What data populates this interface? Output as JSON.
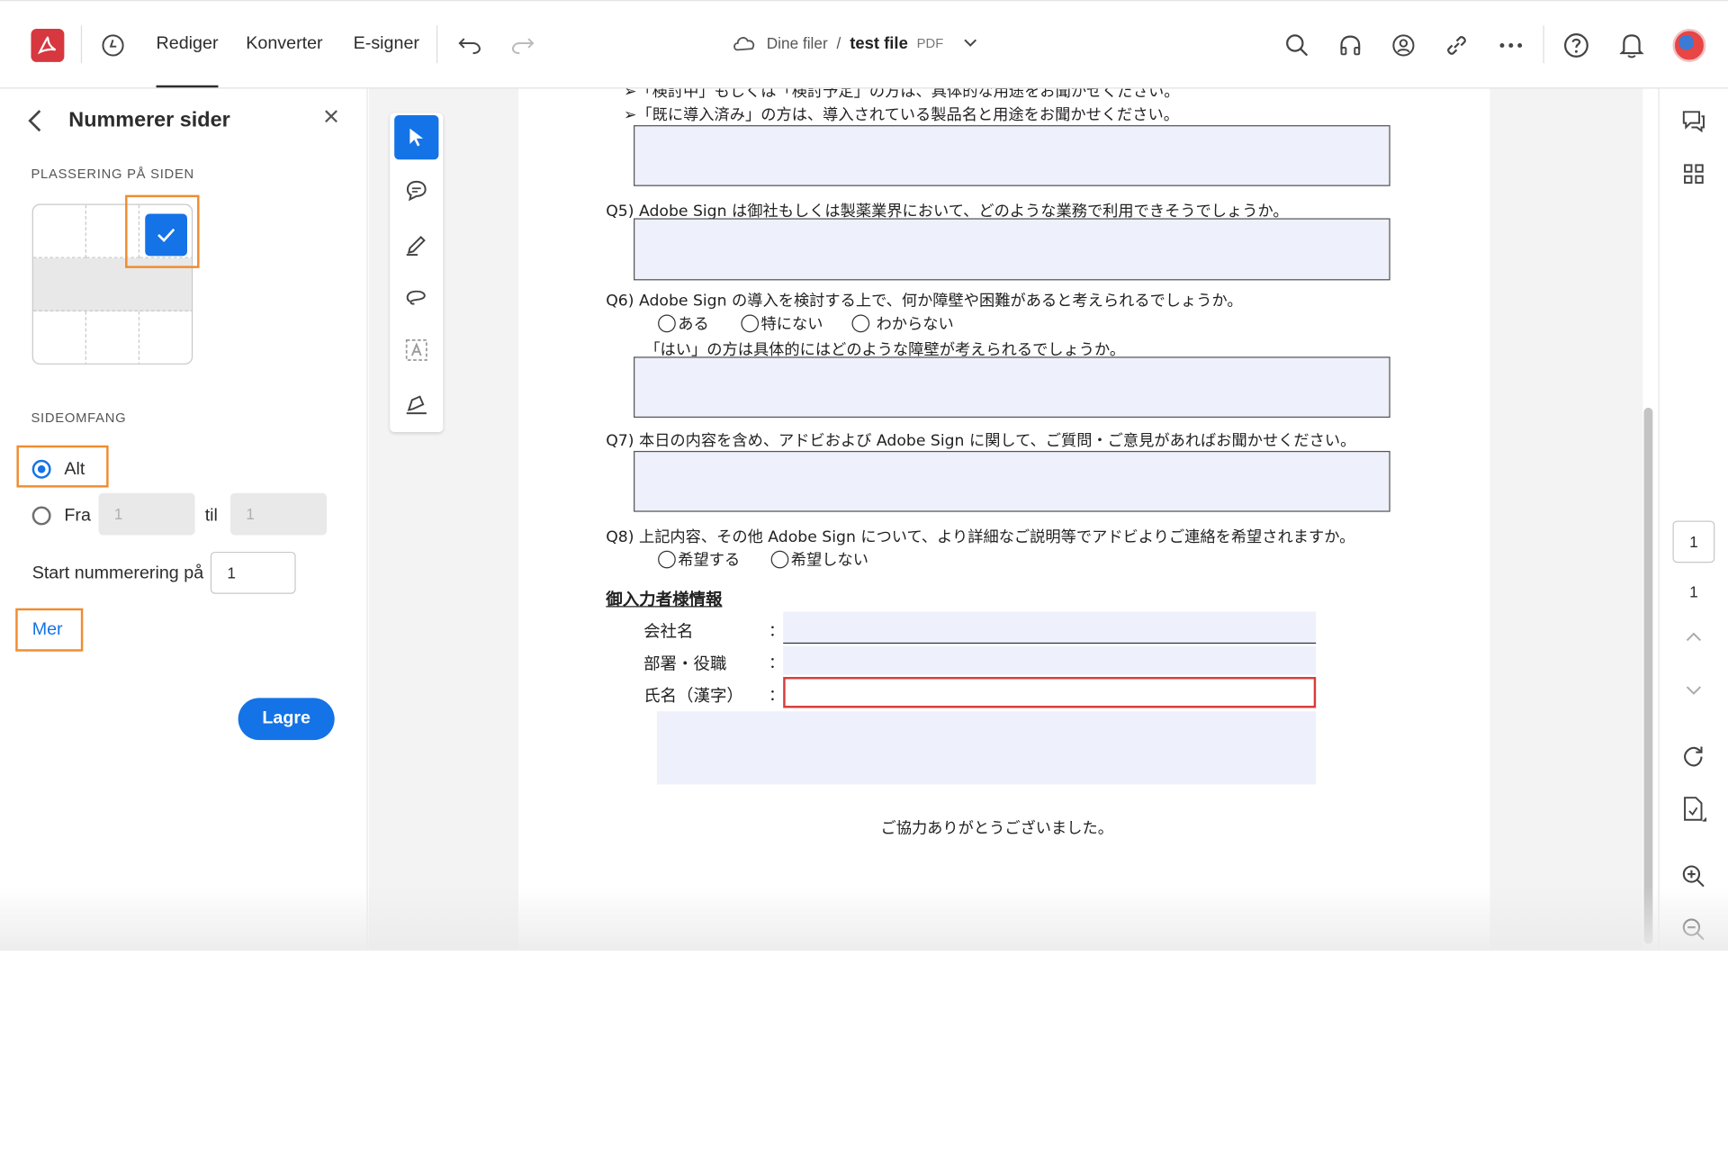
{
  "app": {
    "logo_glyph": "A",
    "brand_color": "#d7373f",
    "accent_color": "#1473e6",
    "highlight_color": "#f08c30"
  },
  "nav": {
    "tabs": [
      "Rediger",
      "Konverter",
      "E-signer"
    ],
    "active_tab": "Rediger"
  },
  "breadcrumb": {
    "location": "Dine filer",
    "separator": "/",
    "file_name": "test file",
    "file_type": "PDF"
  },
  "panel": {
    "title": "Nummerer sider",
    "placement_label": "PLASSERING PÅ SIDEN",
    "selected_position": "top-right",
    "range_label": "SIDEOMFANG",
    "option_all": "Alt",
    "option_from": "Fra",
    "from_value": "1",
    "to_label": "til",
    "to_value": "1",
    "start_label": "Start nummerering på",
    "start_value": "1",
    "more_link": "Mer",
    "save_button": "Lagre"
  },
  "document": {
    "line_a": "➢「検討中」もしくは「検討予定」の方は、具体的な用途をお聞かせください。",
    "line_b": "➢「既に導入済み」の方は、導入されている製品名と用途をお聞かせください。",
    "q5": "Q5) Adobe Sign は御社もしくは製薬業界において、どのような業務で利用できそうでしょうか。",
    "q6": "Q6) Adobe Sign の導入を検討する上で、何か障壁や困難があると考えられるでしょうか。",
    "q6_options": [
      "ある",
      "特にない",
      "わからない"
    ],
    "q6_follow": "「はい」の方は具体的にはどのような障壁が考えられるでしょうか。",
    "q7": "Q7) 本日の内容を含め、アドビおよび Adobe Sign に関して、ご質問・ご意見があればお聞かせください。",
    "q8": "Q8) 上記内容、その他 Adobe Sign について、より詳細なご説明等でアドビよりご連絡を希望されますか。",
    "q8_options": [
      "希望する",
      "希望しない"
    ],
    "info_heading": "御入力者様情報",
    "fields": [
      "会社名",
      "部署・役職",
      "氏名（漢字）"
    ],
    "colon": "：",
    "thanks": "ご協力ありがとうございました。"
  },
  "pagination": {
    "current_page": "1",
    "total_pages": "1"
  },
  "icons": [
    "history-icon",
    "undo-icon",
    "redo-icon",
    "cloud-icon",
    "chevron-down-icon",
    "search-icon",
    "headphones-icon",
    "share-user-icon",
    "link-icon",
    "more-icon",
    "help-icon",
    "bell-icon",
    "select-tool-icon",
    "comment-tool-icon",
    "highlight-tool-icon",
    "lasso-tool-icon",
    "text-tool-icon",
    "sign-tool-icon",
    "comments-panel-icon",
    "thumbnails-icon",
    "chevron-up-icon",
    "rotate-icon",
    "extract-page-icon",
    "zoom-in-icon",
    "zoom-out-icon"
  ]
}
